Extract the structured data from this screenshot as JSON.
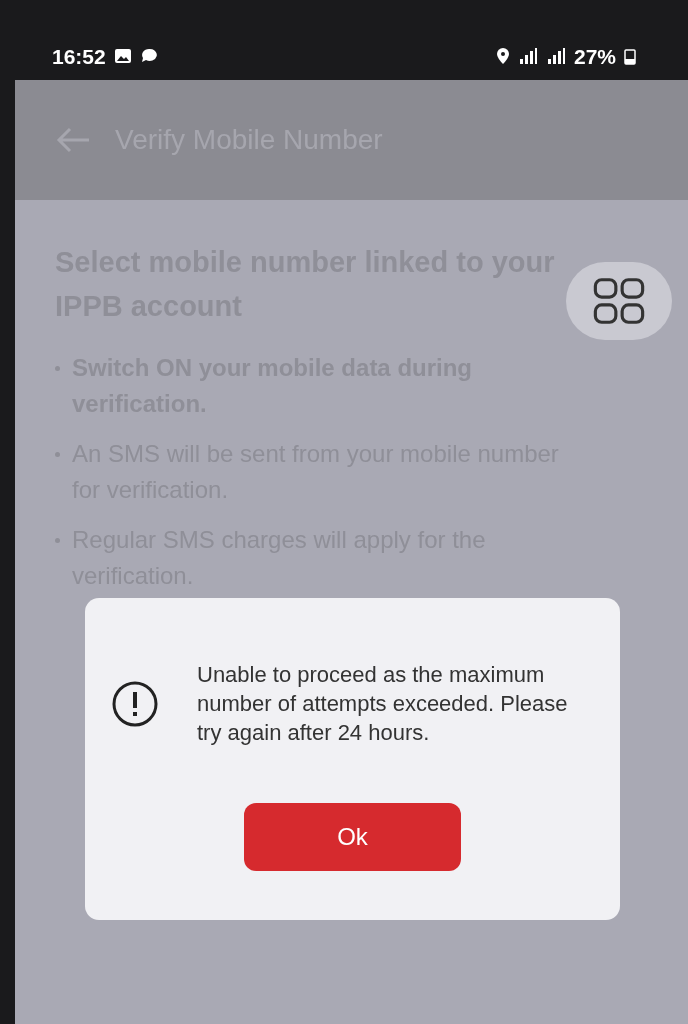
{
  "status_bar": {
    "time": "16:52",
    "battery": "27%"
  },
  "app_bar": {
    "title": "Verify Mobile Number"
  },
  "heading": "Select mobile number linked to your IPPB account",
  "bullets": [
    {
      "text": "Switch ON your mobile data during verification.",
      "bold": true
    },
    {
      "text": "An SMS will be sent from your mobile number for verification.",
      "bold": false
    },
    {
      "text": "Regular SMS charges will apply for the verification.",
      "bold": false
    }
  ],
  "dialog": {
    "message": "Unable to proceed as the maximum number of attempts exceeded. Please try again after 24 hours.",
    "button": "Ok"
  }
}
